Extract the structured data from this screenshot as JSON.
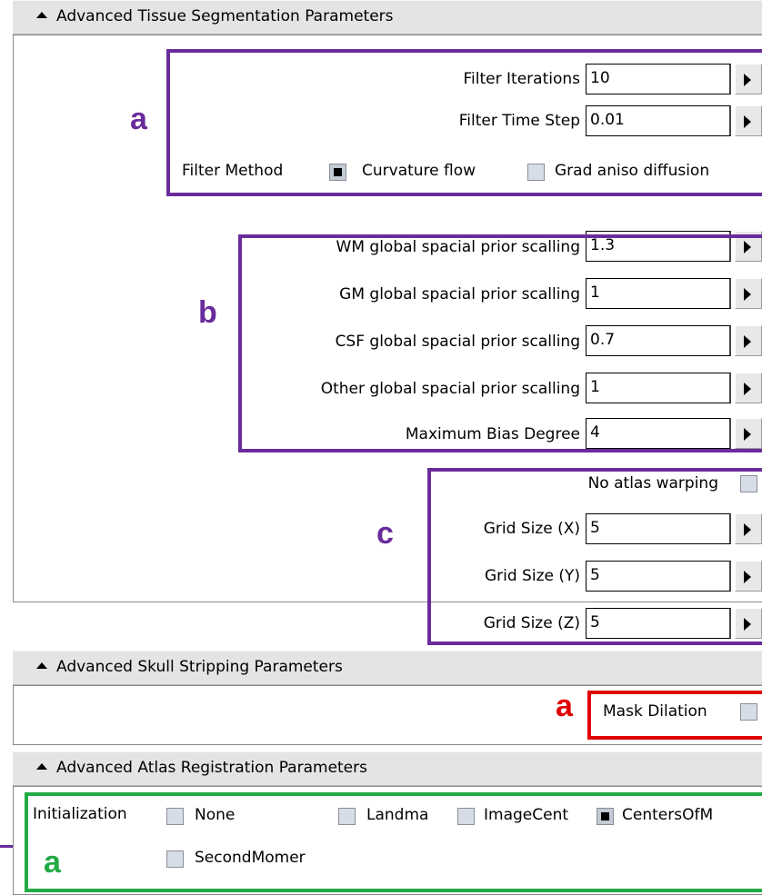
{
  "sections": {
    "tissue": {
      "title": "Advanced Tissue Segmentation Parameters",
      "filter_iterations": {
        "label": "Filter Iterations",
        "value": "10"
      },
      "filter_time_step": {
        "label": "Filter Time Step",
        "value": "0.01"
      },
      "filter_method": {
        "label": "Filter Method",
        "options": [
          {
            "label": "Curvature flow",
            "checked": true
          },
          {
            "label": "Grad aniso diffusion",
            "checked": false
          }
        ]
      },
      "wm_prior": {
        "label": "WM global spacial prior scalling",
        "value": "1.3"
      },
      "gm_prior": {
        "label": "GM global spacial prior scalling",
        "value": "1"
      },
      "csf_prior": {
        "label": "CSF global spacial prior scalling",
        "value": "0.7"
      },
      "other_prior": {
        "label": "Other global spacial prior scalling",
        "value": "1"
      },
      "max_bias": {
        "label": "Maximum Bias Degree",
        "value": "4"
      },
      "no_atlas_warping": {
        "label": "No atlas warping",
        "checked": false
      },
      "grid_x": {
        "label": "Grid Size (X)",
        "value": "5"
      },
      "grid_y": {
        "label": "Grid Size (Y)",
        "value": "5"
      },
      "grid_z": {
        "label": "Grid Size (Z)",
        "value": "5"
      }
    },
    "skull": {
      "title": "Advanced Skull Stripping Parameters",
      "mask_dilation": {
        "label": "Mask Dilation",
        "checked": false
      }
    },
    "atlas": {
      "title": "Advanced Atlas Registration Parameters",
      "initialization": {
        "label": "Initialization",
        "options": [
          {
            "label": "None",
            "checked": false
          },
          {
            "label": "Landma",
            "checked": false
          },
          {
            "label": "ImageCent",
            "checked": false
          },
          {
            "label": "CentersOfM",
            "checked": true
          },
          {
            "label": "SecondMomer",
            "checked": false
          }
        ]
      }
    }
  },
  "annotations": {
    "tissue_a": "a",
    "tissue_b": "b",
    "tissue_c": "c",
    "skull_a": "a",
    "atlas_a": "a"
  },
  "colors": {
    "purple": "#6a2c9c",
    "red": "#e00000",
    "green": "#22aa44"
  },
  "icons": {
    "section_toggle": "collapse-triangle-icon",
    "spinner": "right-arrow-icon"
  }
}
